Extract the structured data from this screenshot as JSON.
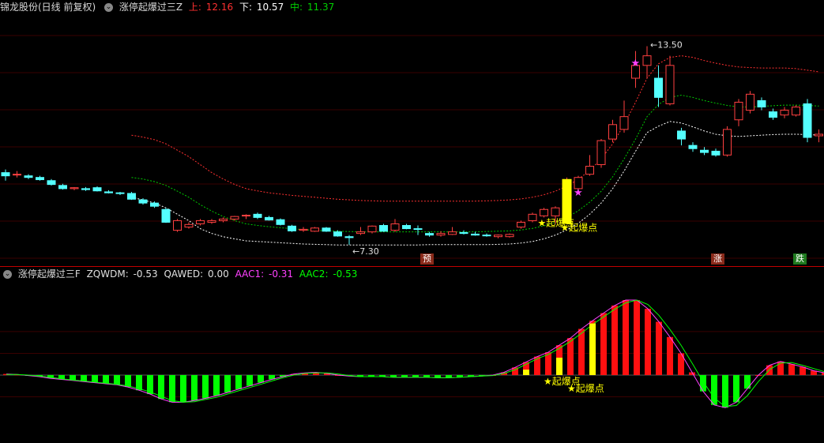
{
  "top_header": {
    "stock_name": "锦龙股份(日线 前复权)",
    "indicator": "涨停起爆过三Z",
    "upper_label": "上:",
    "upper_value": "12.16",
    "lower_label": "下:",
    "lower_value": "10.57",
    "mid_label": "中:",
    "mid_value": "11.37"
  },
  "bottom_header": {
    "indicator": "涨停起爆过三F",
    "zqwdm_label": "ZQWDM:",
    "zqwdm_value": "-0.53",
    "qawed_label": "QAWED:",
    "qawed_value": "0.00",
    "aac1_label": "AAC1:",
    "aac1_value": "-0.31",
    "aac2_label": "AAC2:",
    "aac2_value": "-0.53"
  },
  "price_labels": {
    "high": "13.50",
    "low": "7.30"
  },
  "signals": {
    "pre": "预",
    "rise": "涨",
    "fall": "跌",
    "boom": "起爆点",
    "star": "★"
  },
  "colors": {
    "up": "#ff4040",
    "down": "#54ffff",
    "upper_band": "#ff3030",
    "mid_band": "#00c800",
    "lower_band": "#ffffff",
    "hist_pos": "#ff1010",
    "hist_neg": "#00ff00",
    "aac1": "#ff40ff",
    "aac2": "#00ff00",
    "signal_yellow": "#ffff00",
    "magenta": "#ff40ff"
  },
  "chart_data": [
    {
      "type": "candlestick",
      "title": "锦龙股份(日线 前复权)",
      "ylim": [
        7.0,
        14.4
      ],
      "candles": [
        [
          9.55,
          9.65,
          9.3,
          9.45
        ],
        [
          9.5,
          9.6,
          9.4,
          9.5
        ],
        [
          9.45,
          9.5,
          9.35,
          9.4
        ],
        [
          9.4,
          9.45,
          9.3,
          9.33
        ],
        [
          9.3,
          9.35,
          9.15,
          9.18
        ],
        [
          9.15,
          9.2,
          9.02,
          9.05
        ],
        [
          9.05,
          9.1,
          9.0,
          9.08
        ],
        [
          9.05,
          9.1,
          8.98,
          9.02
        ],
        [
          9.08,
          9.12,
          8.96,
          8.98
        ],
        [
          8.95,
          9.0,
          8.9,
          8.92
        ],
        [
          8.92,
          8.95,
          8.85,
          8.9
        ],
        [
          8.9,
          8.95,
          8.7,
          8.72
        ],
        [
          8.7,
          8.75,
          8.55,
          8.6
        ],
        [
          8.6,
          8.65,
          8.45,
          8.5
        ],
        [
          8.4,
          8.45,
          7.98,
          8.0
        ],
        [
          7.75,
          8.1,
          7.7,
          8.05
        ],
        [
          7.85,
          8.0,
          7.8,
          7.93
        ],
        [
          7.95,
          8.1,
          7.9,
          8.05
        ],
        [
          8.0,
          8.1,
          7.95,
          8.05
        ],
        [
          8.05,
          8.15,
          8.0,
          8.1
        ],
        [
          8.1,
          8.2,
          8.05,
          8.18
        ],
        [
          8.2,
          8.25,
          8.1,
          8.22
        ],
        [
          8.25,
          8.3,
          8.1,
          8.15
        ],
        [
          8.15,
          8.2,
          8.05,
          8.07
        ],
        [
          8.08,
          8.12,
          7.9,
          7.93
        ],
        [
          7.88,
          7.92,
          7.7,
          7.73
        ],
        [
          7.75,
          7.85,
          7.7,
          7.78
        ],
        [
          7.72,
          7.85,
          7.7,
          7.82
        ],
        [
          7.82,
          7.85,
          7.7,
          7.72
        ],
        [
          7.7,
          7.75,
          7.55,
          7.57
        ],
        [
          7.55,
          7.6,
          7.3,
          7.52
        ],
        [
          7.65,
          7.85,
          7.6,
          7.7
        ],
        [
          7.7,
          7.9,
          7.65,
          7.88
        ],
        [
          7.9,
          7.95,
          7.7,
          7.72
        ],
        [
          7.75,
          8.1,
          7.7,
          7.95
        ],
        [
          7.9,
          7.95,
          7.78,
          7.8
        ],
        [
          7.8,
          7.9,
          7.6,
          7.78
        ],
        [
          7.65,
          7.7,
          7.55,
          7.6
        ],
        [
          7.6,
          7.72,
          7.55,
          7.65
        ],
        [
          7.62,
          7.85,
          7.6,
          7.7
        ],
        [
          7.68,
          7.75,
          7.62,
          7.65
        ],
        [
          7.63,
          7.7,
          7.58,
          7.6
        ],
        [
          7.6,
          7.65,
          7.55,
          7.58
        ],
        [
          7.55,
          7.62,
          7.5,
          7.6
        ],
        [
          7.55,
          7.65,
          7.52,
          7.62
        ],
        [
          7.85,
          8.05,
          7.8,
          8.0
        ],
        [
          8.05,
          8.3,
          8.0,
          8.25
        ],
        [
          8.2,
          8.45,
          8.15,
          8.4
        ],
        [
          8.2,
          8.5,
          7.95,
          8.45
        ],
        [
          8.8,
          9.4,
          8.75,
          9.25
        ],
        [
          9.05,
          9.45,
          9.0,
          9.4
        ],
        [
          9.5,
          10.1,
          9.45,
          9.75
        ],
        [
          9.8,
          10.6,
          9.7,
          10.55
        ],
        [
          10.6,
          11.2,
          10.5,
          11.05
        ],
        [
          10.9,
          11.8,
          10.8,
          11.3
        ],
        [
          12.5,
          13.35,
          12.2,
          12.9
        ],
        [
          12.9,
          13.5,
          12.5,
          13.2
        ],
        [
          12.5,
          12.9,
          11.6,
          11.9
        ],
        [
          11.7,
          13.2,
          11.65,
          12.9
        ],
        [
          10.85,
          10.95,
          10.4,
          10.6
        ],
        [
          10.4,
          10.5,
          10.2,
          10.3
        ],
        [
          10.25,
          10.35,
          10.1,
          10.18
        ],
        [
          10.22,
          10.3,
          10.05,
          10.1
        ],
        [
          10.1,
          11.0,
          10.05,
          10.9
        ],
        [
          11.2,
          11.85,
          11.0,
          11.75
        ],
        [
          11.5,
          12.1,
          11.4,
          12.0
        ],
        [
          11.8,
          11.9,
          11.5,
          11.6
        ],
        [
          11.45,
          11.55,
          11.2,
          11.28
        ],
        [
          11.35,
          11.6,
          11.25,
          11.5
        ],
        [
          11.35,
          11.65,
          11.3,
          11.6
        ],
        [
          11.7,
          11.85,
          10.5,
          10.65
        ],
        [
          10.7,
          10.9,
          10.5,
          10.75
        ]
      ],
      "upper_band": [
        null,
        null,
        null,
        null,
        null,
        null,
        null,
        null,
        null,
        null,
        null,
        10.72,
        10.66,
        10.58,
        10.45,
        10.25,
        10.05,
        9.8,
        9.55,
        9.35,
        9.18,
        9.05,
        8.98,
        8.92,
        8.88,
        8.84,
        8.81,
        8.78,
        8.75,
        8.72,
        8.7,
        8.68,
        8.67,
        8.66,
        8.66,
        8.66,
        8.66,
        8.66,
        8.66,
        8.66,
        8.66,
        8.66,
        8.67,
        8.68,
        8.7,
        8.73,
        8.78,
        8.86,
        8.97,
        9.13,
        9.34,
        9.62,
        9.98,
        10.45,
        11.05,
        11.75,
        12.5,
        12.95,
        13.15,
        13.2,
        13.15,
        13.05,
        12.97,
        12.9,
        12.85,
        12.83,
        12.82,
        12.82,
        12.82,
        12.8,
        12.75,
        12.7
      ],
      "mid_band": [
        null,
        null,
        null,
        null,
        null,
        null,
        null,
        null,
        null,
        null,
        null,
        9.4,
        9.35,
        9.27,
        9.15,
        8.97,
        8.78,
        8.55,
        8.35,
        8.18,
        8.05,
        7.95,
        7.9,
        7.86,
        7.83,
        7.8,
        7.77,
        7.75,
        7.73,
        7.72,
        7.71,
        7.7,
        7.7,
        7.7,
        7.7,
        7.7,
        7.7,
        7.7,
        7.7,
        7.7,
        7.7,
        7.7,
        7.71,
        7.72,
        7.73,
        7.76,
        7.81,
        7.89,
        8.0,
        8.15,
        8.36,
        8.63,
        8.97,
        9.42,
        9.98,
        10.6,
        11.3,
        11.68,
        11.9,
        11.97,
        11.9,
        11.8,
        11.72,
        11.65,
        11.6,
        11.6,
        11.62,
        11.64,
        11.66,
        11.66,
        11.65,
        11.63
      ],
      "lower_band": [
        null,
        null,
        null,
        null,
        null,
        null,
        null,
        null,
        null,
        null,
        null,
        8.78,
        8.7,
        8.6,
        8.45,
        8.25,
        8.05,
        7.8,
        7.65,
        7.55,
        7.48,
        7.42,
        7.4,
        7.38,
        7.36,
        7.34,
        7.32,
        7.31,
        7.3,
        7.29,
        7.29,
        7.29,
        7.29,
        7.29,
        7.29,
        7.29,
        7.29,
        7.3,
        7.3,
        7.3,
        7.3,
        7.3,
        7.3,
        7.31,
        7.32,
        7.35,
        7.4,
        7.48,
        7.6,
        7.76,
        7.97,
        8.25,
        8.6,
        9.05,
        9.6,
        10.22,
        10.8,
        11.0,
        11.15,
        11.1,
        10.98,
        10.85,
        10.75,
        10.7,
        10.68,
        10.7,
        10.72,
        10.74,
        10.75,
        10.75,
        10.74,
        10.72
      ]
    },
    {
      "type": "bar",
      "title": "涨停起爆过三F",
      "ylim": [
        -0.8,
        1.7
      ],
      "series": [
        {
          "name": "ZQWDM",
          "values": [
            0.02,
            0.01,
            -0.01,
            -0.03,
            -0.06,
            -0.08,
            -0.1,
            -0.12,
            -0.14,
            -0.16,
            -0.18,
            -0.22,
            -0.28,
            -0.35,
            -0.44,
            -0.5,
            -0.5,
            -0.47,
            -0.43,
            -0.38,
            -0.32,
            -0.26,
            -0.2,
            -0.14,
            -0.08,
            -0.03,
            0.02,
            0.04,
            0.05,
            0.03,
            0.0,
            -0.02,
            -0.03,
            -0.03,
            -0.03,
            -0.04,
            -0.04,
            -0.04,
            -0.04,
            -0.05,
            -0.05,
            -0.04,
            -0.03,
            -0.02,
            0.0,
            0.05,
            0.14,
            0.24,
            0.34,
            0.42,
            0.55,
            0.68,
            0.85,
            1.0,
            1.14,
            1.28,
            1.38,
            1.38,
            1.22,
            0.98,
            0.7,
            0.4,
            0.05,
            -0.3,
            -0.55,
            -0.6,
            -0.5,
            -0.25,
            0.0,
            0.18,
            0.25,
            0.2,
            0.15,
            0.08,
            0.04,
            -0.05,
            -0.12
          ]
        },
        {
          "name": "AAC1",
          "values": [
            0.02,
            0.01,
            -0.01,
            -0.03,
            -0.06,
            -0.08,
            -0.1,
            -0.12,
            -0.14,
            -0.16,
            -0.18,
            -0.22,
            -0.28,
            -0.35,
            -0.44,
            -0.5,
            -0.5,
            -0.47,
            -0.43,
            -0.38,
            -0.32,
            -0.26,
            -0.2,
            -0.14,
            -0.08,
            -0.03,
            0.02,
            0.04,
            0.05,
            0.03,
            0.0,
            -0.02,
            -0.03,
            -0.03,
            -0.03,
            -0.04,
            -0.04,
            -0.04,
            -0.04,
            -0.05,
            -0.05,
            -0.04,
            -0.03,
            -0.02,
            0.0,
            0.05,
            0.14,
            0.24,
            0.34,
            0.42,
            0.55,
            0.68,
            0.85,
            1.0,
            1.14,
            1.28,
            1.38,
            1.38,
            1.22,
            0.98,
            0.7,
            0.4,
            0.05,
            -0.3,
            -0.55,
            -0.6,
            -0.5,
            -0.25,
            0.0,
            0.18,
            0.25,
            0.2,
            0.15,
            0.08,
            0.04,
            -0.05,
            -0.12
          ]
        },
        {
          "name": "AAC2",
          "values": [
            0.01,
            0.01,
            0.0,
            -0.02,
            -0.04,
            -0.07,
            -0.09,
            -0.11,
            -0.13,
            -0.15,
            -0.17,
            -0.2,
            -0.25,
            -0.31,
            -0.39,
            -0.47,
            -0.5,
            -0.49,
            -0.45,
            -0.41,
            -0.35,
            -0.29,
            -0.23,
            -0.17,
            -0.11,
            -0.05,
            0.0,
            0.03,
            0.04,
            0.04,
            0.02,
            -0.01,
            -0.03,
            -0.03,
            -0.03,
            -0.04,
            -0.04,
            -0.04,
            -0.04,
            -0.05,
            -0.05,
            -0.04,
            -0.03,
            -0.02,
            -0.01,
            0.03,
            0.1,
            0.2,
            0.3,
            0.38,
            0.49,
            0.62,
            0.77,
            0.93,
            1.07,
            1.21,
            1.33,
            1.38,
            1.3,
            1.1,
            0.84,
            0.55,
            0.22,
            -0.12,
            -0.42,
            -0.58,
            -0.56,
            -0.38,
            -0.12,
            0.1,
            0.22,
            0.23,
            0.18,
            0.12,
            0.06,
            -0.01,
            -0.09
          ]
        }
      ]
    }
  ]
}
